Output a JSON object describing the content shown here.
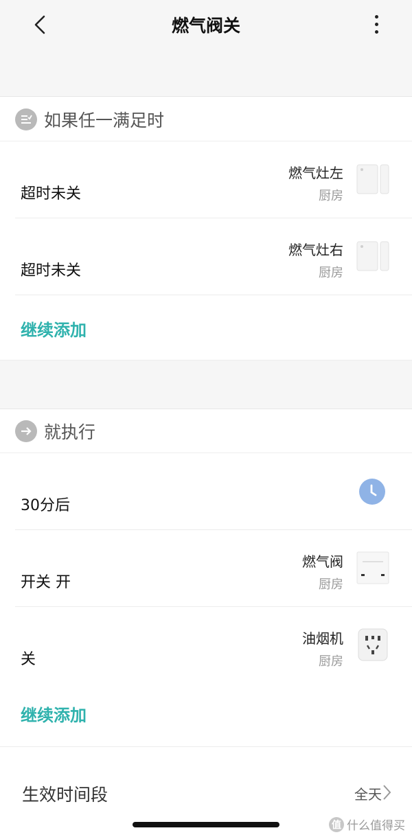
{
  "header": {
    "title": "燃气阀关"
  },
  "conditions": {
    "label": "如果任一满足时",
    "items": [
      {
        "trigger": "超时未关",
        "device": "燃气灶左",
        "room": "厨房"
      },
      {
        "trigger": "超时未关",
        "device": "燃气灶右",
        "room": "厨房"
      }
    ],
    "add_label": "继续添加"
  },
  "actions": {
    "label": "就执行",
    "items": [
      {
        "action": "30分后",
        "device": "",
        "room": ""
      },
      {
        "action": "开关 开",
        "device": "燃气阀",
        "room": "厨房"
      },
      {
        "action": "关",
        "device": "油烟机",
        "room": "厨房"
      }
    ],
    "add_label": "继续添加"
  },
  "schedule": {
    "label": "生效时间段",
    "value": "全天"
  },
  "watermark": {
    "badge": "值",
    "text": "什么值得买"
  },
  "colors": {
    "accent": "#2fb2ad",
    "timer_icon": "#8fb3e6"
  }
}
